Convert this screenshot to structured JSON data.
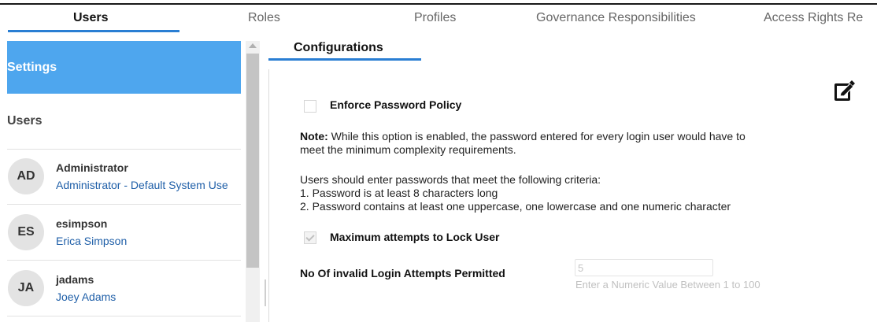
{
  "tabs": [
    {
      "label": "Users",
      "active": true
    },
    {
      "label": "Roles",
      "active": false
    },
    {
      "label": "Profiles",
      "active": false
    },
    {
      "label": "Governance Responsibilities",
      "active": false
    },
    {
      "label": "Access Rights Re",
      "active": false
    }
  ],
  "sidebar": {
    "settings_label": "Settings",
    "users_label": "Users",
    "users": [
      {
        "initials": "AD",
        "username": "Administrator",
        "full_name": "Administrator - Default System Use"
      },
      {
        "initials": "ES",
        "username": "esimpson",
        "full_name": "Erica Simpson"
      },
      {
        "initials": "JA",
        "username": "jadams",
        "full_name": "Joey Adams"
      }
    ]
  },
  "content": {
    "subtab_label": "Configurations",
    "enforce_policy": {
      "label": "Enforce Password Policy",
      "checked": false
    },
    "note_prefix": "Note:",
    "note_text": " While this option is enabled, the password entered for every login user would have to",
    "note_text_2": "meet the minimum complexity requirements.",
    "criteria_intro": "Users should enter passwords that meet the following criteria:",
    "criteria": [
      "1. Password is at least 8 characters long",
      "2. Password contains at least one uppercase, one lowercase and one numeric character"
    ],
    "max_attempts": {
      "label": "Maximum attempts to Lock User",
      "checked": true
    },
    "invalid_attempts_label": "No Of invalid Login Attempts Permitted",
    "invalid_attempts_value": "5",
    "invalid_attempts_hint": "Enter a Numeric Value Between 1 to 100"
  },
  "colors": {
    "accent": "#2a7ed3",
    "sidebar_selected": "#4ea6ee",
    "link": "#1f5fa8"
  },
  "icons": {
    "edit": "pencil-edit-icon",
    "scroll_up": "scroll-up-arrow-icon"
  }
}
